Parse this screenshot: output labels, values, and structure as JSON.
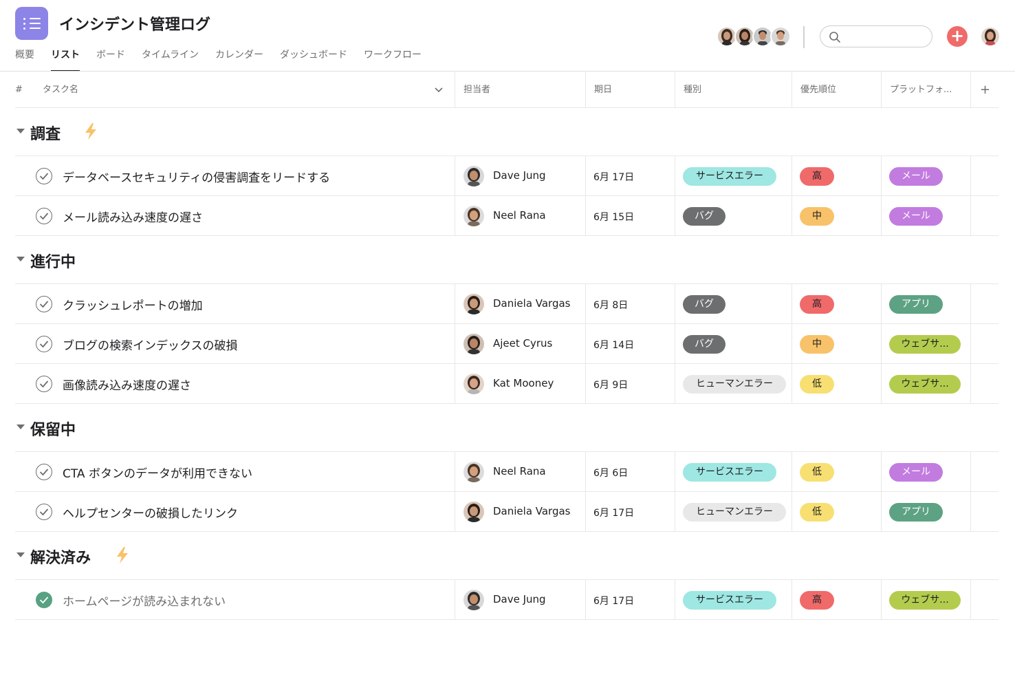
{
  "app": {
    "title": "インシデント管理ログ",
    "icon": "list-icon",
    "accent": "#8d84e8"
  },
  "tabs": [
    {
      "label": "概要",
      "active": false
    },
    {
      "label": "リスト",
      "active": true
    },
    {
      "label": "ボード",
      "active": false
    },
    {
      "label": "タイムライン",
      "active": false
    },
    {
      "label": "カレンダー",
      "active": false
    },
    {
      "label": "ダッシュボード",
      "active": false
    },
    {
      "label": "ワークフロー",
      "active": false
    }
  ],
  "toolbar": {
    "search_value": "",
    "add_icon": "plus-icon",
    "add_color": "#f06a6a"
  },
  "columns": {
    "number": "#",
    "task": "タスク名",
    "assignee": "担当者",
    "due": "期日",
    "type": "種別",
    "priority": "優先順位",
    "platform": "プラットフォ...",
    "add": "+"
  },
  "colors": {
    "service_error": "#9ee7e3",
    "bug": "#6d6e6f",
    "human_error": "#e8e8e8",
    "high": "#f06a6a",
    "medium": "#f8c26a",
    "low": "#f8df72",
    "mail": "#c27ce0",
    "app": "#5da283",
    "web": "#b4cc4e",
    "done": "#58a182"
  },
  "sections": [
    {
      "title": "調査",
      "bolt": true,
      "tasks": [
        {
          "name": "データベースセキュリティの侵害調査をリードする",
          "done": false,
          "assignee": "Dave Jung",
          "due": "6月 17日",
          "type": "サービスエラー",
          "priority": "高",
          "platform": "メール"
        },
        {
          "name": "メール読み込み速度の遅さ",
          "done": false,
          "assignee": "Neel Rana",
          "due": "6月 15日",
          "type": "バグ",
          "priority": "中",
          "platform": "メール"
        }
      ]
    },
    {
      "title": "進行中",
      "bolt": false,
      "tasks": [
        {
          "name": "クラッシュレポートの増加",
          "done": false,
          "assignee": "Daniela Vargas",
          "due": "6月 8日",
          "type": "バグ",
          "priority": "高",
          "platform": "アプリ"
        },
        {
          "name": "ブログの検索インデックスの破損",
          "done": false,
          "assignee": "Ajeet Cyrus",
          "due": "6月 14日",
          "type": "バグ",
          "priority": "中",
          "platform": "ウェブサ..."
        },
        {
          "name": "画像読み込み速度の遅さ",
          "done": false,
          "assignee": "Kat Mooney",
          "due": "6月 9日",
          "type": "ヒューマンエラー",
          "priority": "低",
          "platform": "ウェブサ..."
        }
      ]
    },
    {
      "title": "保留中",
      "bolt": false,
      "tasks": [
        {
          "name": "CTA ボタンのデータが利用できない",
          "done": false,
          "assignee": "Neel Rana",
          "due": "6月 6日",
          "type": "サービスエラー",
          "priority": "低",
          "platform": "メール"
        },
        {
          "name": "ヘルプセンターの破損したリンク",
          "done": false,
          "assignee": "Daniela Vargas",
          "due": "6月 17日",
          "type": "ヒューマンエラー",
          "priority": "低",
          "platform": "アプリ"
        }
      ]
    },
    {
      "title": "解決済み",
      "bolt": true,
      "tasks": [
        {
          "name": "ホームページが読み込まれない",
          "done": true,
          "assignee": "Dave Jung",
          "due": "6月 17日",
          "type": "サービスエラー",
          "priority": "高",
          "platform": "ウェブサ..."
        }
      ]
    }
  ]
}
